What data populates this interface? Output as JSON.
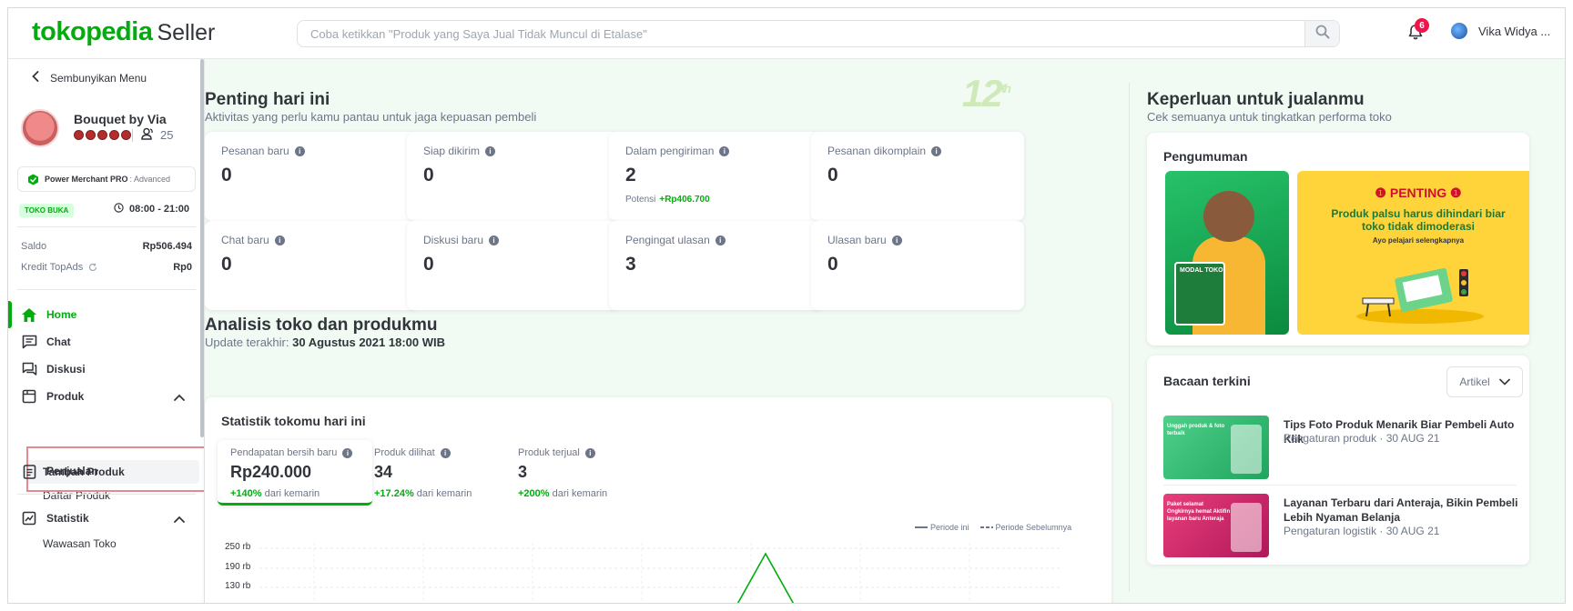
{
  "header": {
    "logo_main": "tokopedia",
    "logo_sub": "Seller",
    "search_placeholder": "Coba ketikkan \"Produk yang Saya Jual Tidak Muncul di Etalase\"",
    "notification_count": "6",
    "user_name": "Vika Widya ..."
  },
  "sidebar": {
    "hide_menu": "Sembunyikan Menu",
    "shop_name": "Bouquet by Via",
    "followers": "25",
    "power_merchant": "Power Merchant PRO",
    "power_merchant_level": ": Advanced",
    "status_badge": "TOKO BUKA",
    "hours": "08:00 - 21:00",
    "saldo_label": "Saldo",
    "saldo_value": "Rp506.494",
    "topads_label": "Kredit TopAds",
    "topads_value": "Rp0",
    "nav": {
      "home": "Home",
      "chat": "Chat",
      "diskusi": "Diskusi",
      "produk": "Produk",
      "tambah_produk": "Tambah Produk",
      "daftar_produk": "Daftar Produk",
      "penjualan": "Penjualan",
      "statistik": "Statistik",
      "wawasan_toko": "Wawasan Toko"
    },
    "accent_color": "#03ac0e"
  },
  "main": {
    "penting": {
      "title": "Penting hari ini",
      "subtitle": "Aktivitas yang perlu kamu pantau untuk jaga kepuasan pembeli",
      "cards": [
        {
          "label": "Pesanan baru",
          "value": "0"
        },
        {
          "label": "Siap dikirim",
          "value": "0"
        },
        {
          "label": "Dalam pengiriman",
          "value": "2",
          "extra_label": "Potensi",
          "extra_value": "+Rp406.700"
        },
        {
          "label": "Pesanan dikomplain",
          "value": "0"
        },
        {
          "label": "Chat baru",
          "value": "0"
        },
        {
          "label": "Diskusi baru",
          "value": "0"
        },
        {
          "label": "Pengingat ulasan",
          "value": "3"
        },
        {
          "label": "Ulasan baru",
          "value": "0"
        }
      ]
    },
    "analisis": {
      "title": "Analisis toko dan produkmu",
      "update_label": "Update terakhir:",
      "update_value": "30 Agustus 2021 18:00 WIB",
      "card_title": "Statistik tokomu hari ini",
      "metrics": [
        {
          "label": "Pendapatan bersih baru",
          "value": "Rp240.000",
          "change": "+140%",
          "change_suffix": "dari kemarin"
        },
        {
          "label": "Produk dilihat",
          "value": "34",
          "change": "+17.24%",
          "change_suffix": "dari kemarin"
        },
        {
          "label": "Produk terjual",
          "value": "3",
          "change": "+200%",
          "change_suffix": "dari kemarin"
        }
      ],
      "legend_current": "Periode ini",
      "legend_previous": "Periode Sebelumnya",
      "y_ticks": [
        "250 rb",
        "190 rb",
        "130 rb"
      ]
    },
    "decoration": "12",
    "decoration_sup": "th"
  },
  "right_panel": {
    "title": "Keperluan untuk jualanmu",
    "subtitle": "Cek semuanya untuk tingkatkan performa toko",
    "announcement": {
      "heading": "Pengumuman",
      "banner1_label": "MODAL TOKO",
      "banner2_title": "PENTING",
      "banner2_text": "Produk palsu harus dihindari biar toko tidak dimoderasi",
      "banner2_small": "Ayo pelajari selengkapnya"
    },
    "reading": {
      "heading": "Bacaan terkini",
      "filter": "Artikel",
      "articles": [
        {
          "title": "Tips Foto Produk Menarik Biar Pembeli Auto Klik",
          "meta": "Pengaturan produk · 30 AUG 21",
          "thumb_text": "Unggah produk & foto terbaik"
        },
        {
          "title": "Layanan Terbaru dari Anteraja, Bikin Pembeli Lebih Nyaman Belanja",
          "meta": "Pengaturan logistik · 30 AUG 21",
          "thumb_text": "Paket selamat Ongkirnya hemat Aktifin layanan baru Anteraja"
        }
      ]
    }
  }
}
